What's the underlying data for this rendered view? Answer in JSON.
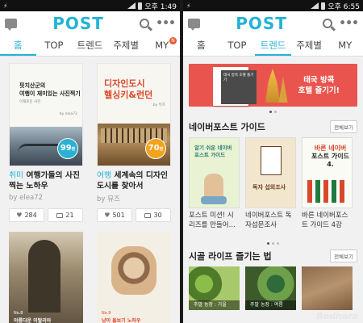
{
  "left": {
    "status": {
      "time": "오후 1:49"
    },
    "logo": "POST",
    "tabs": [
      {
        "label": "홈",
        "active": true
      },
      {
        "label": "TOP",
        "active": false
      },
      {
        "label": "트렌드",
        "active": false
      },
      {
        "label": "주제별",
        "active": false
      },
      {
        "label": "MY",
        "active": false,
        "badge": "N"
      }
    ],
    "cards": [
      {
        "cover_title": "핏치산군의\n여행이 재미있는 사진찍기",
        "cover_sub": "이재로운 사진",
        "cover_credit": "by elea72",
        "count": "99",
        "count_unit": "편",
        "category": "취미",
        "title": "여행가들의 사진 찍는 노하우",
        "author": "by elea72",
        "likes": "284",
        "comments": "21"
      },
      {
        "cover_title": "디자인도시\n헬싱키&런던",
        "cover_credit": "by 뮤즈",
        "count": "70",
        "count_unit": "편",
        "category": "여행",
        "title": "세계속의 디자인 도시를 찾아서",
        "author": "by 뮤즈",
        "likes": "501",
        "comments": "30"
      }
    ],
    "row2": [
      {
        "no": "No.8",
        "title": "아름다운 이탈리아"
      },
      {
        "no": "No.9",
        "title": "냥이 돌보기 노하우"
      }
    ]
  },
  "right": {
    "status": {
      "time": "오후 6:55"
    },
    "logo": "POST",
    "tabs": [
      {
        "label": "홈",
        "active": false
      },
      {
        "label": "TOP",
        "active": false
      },
      {
        "label": "트렌드",
        "active": true
      },
      {
        "label": "주제별",
        "active": false
      },
      {
        "label": "MY",
        "active": false
      }
    ],
    "banner": {
      "book_text": "태국 방콕 호텔 즐기기",
      "text": "태국 방콕\n호텔 즐기기!"
    },
    "guide": {
      "title": "네이버포스트 가이드",
      "more": "전체보기",
      "books": [
        {
          "cover": "알기 쉬운 네이버\n포스트 가이드",
          "name": "포스트 미션! 시리즈를 만들어..."
        },
        {
          "cover": "독자 섭외조사",
          "name": "네이버포스트 독자섭문조사"
        },
        {
          "cover_a": "바른 네이버",
          "cover_b": "포스트 가이드 4.",
          "name": "바른 네이버포스트 가이드 4강"
        }
      ]
    },
    "country": {
      "title": "시골 라이프 즐기는 법",
      "more": "전체보기",
      "items": [
        {
          "label": "주말 농장 : 가을"
        },
        {
          "label": "주말 농장 : 여름"
        },
        {
          "label": ""
        }
      ]
    },
    "watermark": "Bodhara"
  },
  "colors": {
    "accent": "#22b4d6",
    "badge": "#e8572f",
    "banner": "#e9554e",
    "pill_blue": "#2ab1d1",
    "pill_orange": "#f3a31b"
  },
  "icons": [
    "chat-icon",
    "search-icon",
    "more-icon",
    "heart-icon",
    "comment-icon"
  ]
}
